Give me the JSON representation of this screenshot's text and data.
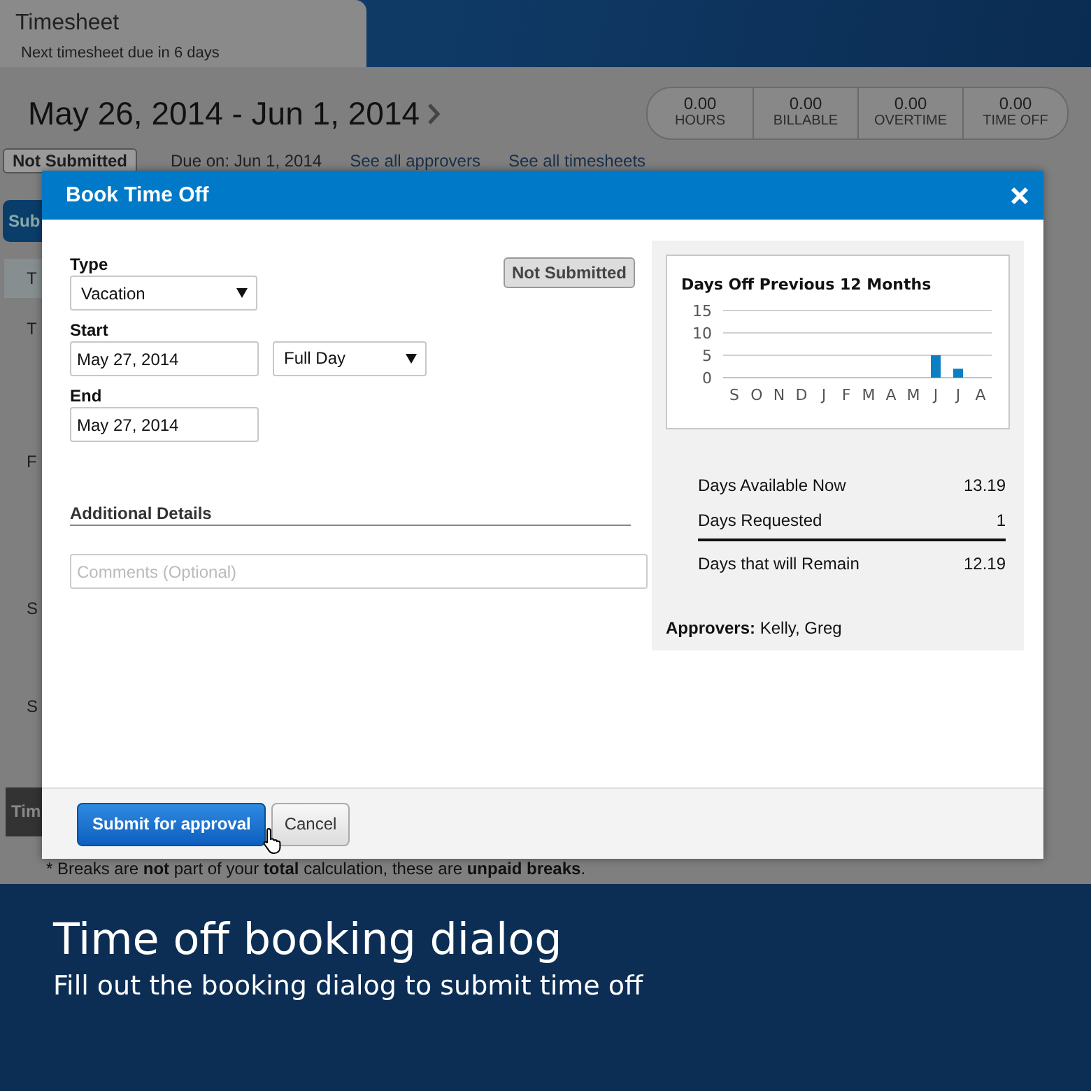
{
  "app": {
    "title": "Timesheet",
    "subtitle": "Next timesheet due in 6 days"
  },
  "period": {
    "label": "May 26, 2014 - Jun 1, 2014"
  },
  "totals": [
    {
      "value": "0.00",
      "label": "HOURS"
    },
    {
      "value": "0.00",
      "label": "BILLABLE"
    },
    {
      "value": "0.00",
      "label": "OVERTIME"
    },
    {
      "value": "0.00",
      "label": "TIME OFF"
    }
  ],
  "status_row": {
    "status": "Not Submitted",
    "due": "Due on: Jun 1, 2014",
    "links": [
      "See all approvers",
      "See all timesheets"
    ]
  },
  "toolbar": {
    "button": "Sub"
  },
  "table_fragments": [
    "T",
    "T",
    "F",
    "S",
    "S"
  ],
  "section_header": "Tim",
  "footnote": "* Breaks are **not** part of your **total** calculation, these are **unpaid breaks**.",
  "dialog": {
    "title": "Book Time Off",
    "status": "Not Submitted",
    "type": {
      "label": "Type",
      "value": "Vacation"
    },
    "start": {
      "label": "Start",
      "value": "May 27, 2014",
      "duration": "Full Day"
    },
    "end": {
      "label": "End",
      "value": "May 27, 2014"
    },
    "details": {
      "heading": "Additional Details",
      "placeholder": "Comments (Optional)"
    },
    "chart_data": {
      "type": "bar",
      "title": "Days Off Previous 12 Months",
      "categories": [
        "S",
        "O",
        "N",
        "D",
        "J",
        "F",
        "M",
        "A",
        "M",
        "J",
        "J",
        "A"
      ],
      "series": [
        {
          "color": "#0a7fc4",
          "values": [
            0,
            0,
            0,
            0,
            0,
            0,
            0,
            0,
            0,
            5,
            2,
            0
          ]
        }
      ],
      "ylim": [
        0,
        15
      ],
      "yticks": [
        0,
        5,
        10,
        15
      ]
    },
    "summary": [
      {
        "label": "Days Available Now",
        "value": "13.19",
        "total": false
      },
      {
        "label": "Days Requested",
        "value": "1",
        "total": false
      },
      {
        "label": "Days that will Remain",
        "value": "12.19",
        "total": true
      }
    ],
    "approvers": {
      "label": "Approvers:",
      "names": "Kelly, Greg"
    },
    "buttons": [
      {
        "label": "Submit for approval",
        "kind": "primary"
      },
      {
        "label": "Cancel",
        "kind": "secondary"
      }
    ]
  },
  "caption": {
    "title": "Time off booking dialog",
    "subtitle": "Fill out the booking dialog to submit time off"
  }
}
